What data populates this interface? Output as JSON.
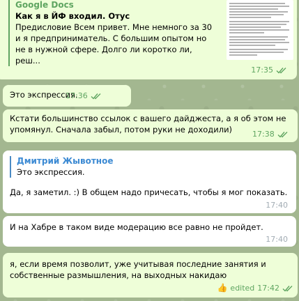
{
  "messages": [
    {
      "link_preview": {
        "site": "Google Docs",
        "title": "Как я в ЙФ входил. Отус",
        "description_lines": [
          "Предисловие Всем привет. Мне немного за 30",
          "и я предприниматель. С большим опытом но",
          "не в нужной сфере. Долго ли коротко ли, реш..."
        ]
      },
      "time": "17:35"
    },
    {
      "text": "Это экспрессия.",
      "time": "17:36"
    },
    {
      "text_lines": [
        "Кстати большинство ссылок с вашего дайджеста, а я об этом не",
        "упомянул. Сначала забыл, потом руки не доходили)"
      ],
      "time": "17:38"
    },
    {
      "reply": {
        "author": "Дмитрий Жывотное",
        "text": "Это экспрессия."
      },
      "text": "Да, я заметил. :) В общем надо причесать, чтобы я мог показать.",
      "time": "17:40"
    },
    {
      "text": "И на Хабре в таком виде модерацию все равно не пройдет.",
      "time": "17:40"
    },
    {
      "text_lines": [
        "я, если время позволит, уже учитывая последние занятия и",
        "собственные размышления, на выходных накидаю"
      ],
      "reaction": "👍",
      "edited": "edited",
      "time": "17:42"
    }
  ],
  "colors": {
    "outgoing_bubble": "#eefed8",
    "incoming_bubble": "#ffffff",
    "accent_green": "#5fa561",
    "reply_author_blue": "#3c8ad3",
    "incoming_time": "#a2acb4"
  },
  "icons": {
    "read": "double-check-icon",
    "reaction": "thumbs-up-icon"
  }
}
